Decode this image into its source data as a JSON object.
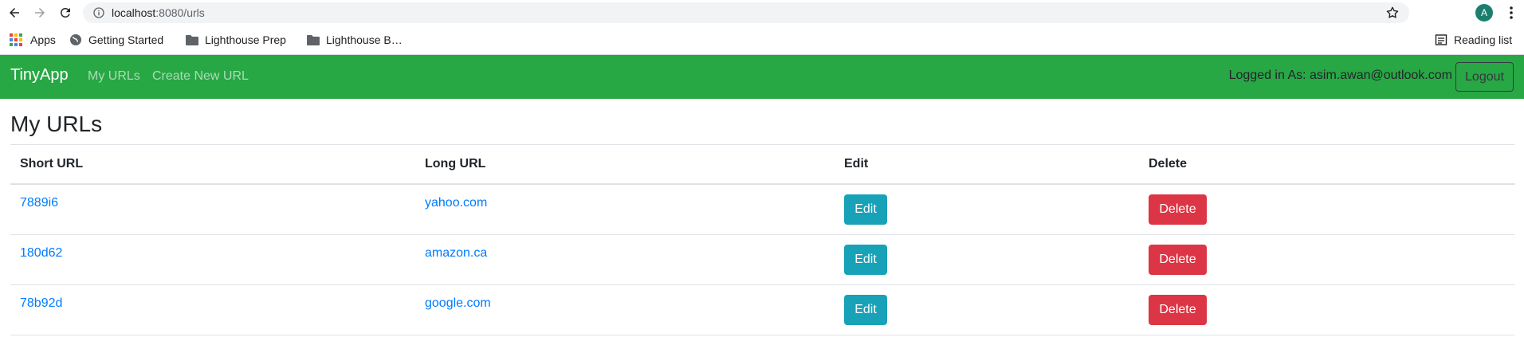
{
  "browser": {
    "url_host": "localhost",
    "url_path": ":8080/urls",
    "avatar_letter": "A",
    "bookmarks": [
      {
        "label": "Apps",
        "icon": "apps-grid-icon"
      },
      {
        "label": "Getting Started",
        "icon": "globe-icon"
      },
      {
        "label": "Lighthouse Prep",
        "icon": "folder-icon"
      },
      {
        "label": "Lighthouse B…",
        "icon": "folder-icon"
      }
    ],
    "reading_list": "Reading list"
  },
  "navbar": {
    "brand": "TinyApp",
    "links": [
      "My URLs",
      "Create New URL"
    ],
    "logged_in": "Logged in As: asim.awan@outlook.com",
    "logout": "Logout"
  },
  "page": {
    "title": "My URLs",
    "columns": [
      "Short URL",
      "Long URL",
      "Edit",
      "Delete"
    ],
    "rows": [
      {
        "short": "7889i6",
        "long": "yahoo.com",
        "edit": "Edit",
        "delete": "Delete"
      },
      {
        "short": "180d62",
        "long": "amazon.ca",
        "edit": "Edit",
        "delete": "Delete"
      },
      {
        "short": "78b92d",
        "long": "google.com",
        "edit": "Edit",
        "delete": "Delete"
      }
    ]
  },
  "colors": {
    "navbar_bg": "#28a745",
    "link": "#007bff",
    "edit_btn": "#17a2b8",
    "delete_btn": "#dc3545"
  }
}
